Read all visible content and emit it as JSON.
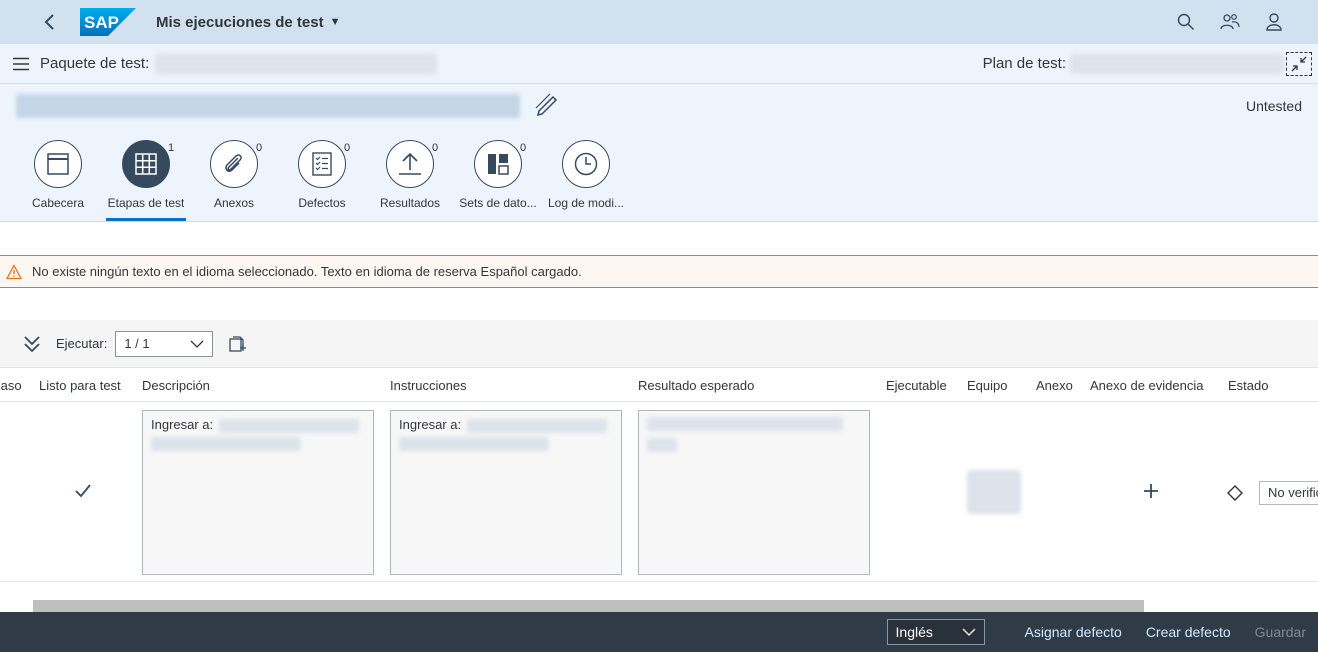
{
  "shell": {
    "app_title": "Mis ejecuciones de test",
    "logo_text": "SAP",
    "icons": [
      "back-icon",
      "search-icon",
      "people-icon",
      "user-icon"
    ]
  },
  "subheader": {
    "package_label": "Paquete de test:",
    "plan_label": "Plan de test:"
  },
  "object": {
    "status": "Untested"
  },
  "tabs": [
    {
      "label": "Cabecera",
      "count": "",
      "icon": "header-icon"
    },
    {
      "label": "Etapas de test",
      "count": "1",
      "icon": "grid-icon"
    },
    {
      "label": "Anexos",
      "count": "0",
      "icon": "paperclip-icon"
    },
    {
      "label": "Defectos",
      "count": "0",
      "icon": "checklist-icon"
    },
    {
      "label": "Resultados",
      "count": "0",
      "icon": "upload-icon"
    },
    {
      "label": "Sets de dato...",
      "count": "0",
      "icon": "layout-icon"
    },
    {
      "label": "Log de modi...",
      "count": "",
      "icon": "clock-icon"
    }
  ],
  "message": {
    "text": "No existe ningún texto en el idioma seleccionado. Texto en idioma de reserva Español cargado."
  },
  "toolbar": {
    "execute_label": "Ejecutar:",
    "execute_value": "1 / 1"
  },
  "table": {
    "columns": [
      "Paso",
      "Listo para test",
      "Descripción",
      "Instrucciones",
      "Resultado esperado",
      "Ejecutable",
      "Equipo",
      "Anexo",
      "Anexo de evidencia",
      "Estado"
    ],
    "row": {
      "description_prefix": "Ingresar a:",
      "instructions_prefix": "Ingresar a:",
      "estado_value": "No verificado"
    }
  },
  "footer": {
    "language": "Inglés",
    "assign_defect": "Asignar defecto",
    "create_defect": "Crear defecto",
    "save": "Guardar"
  },
  "colors": {
    "shell_bg": "#d1e1f0",
    "header_bg": "#edf4fb",
    "accent": "#0a6ed1",
    "icon_dark": "#354a5f",
    "warning": "#e9730c",
    "footer_bg": "#2f3c48"
  }
}
